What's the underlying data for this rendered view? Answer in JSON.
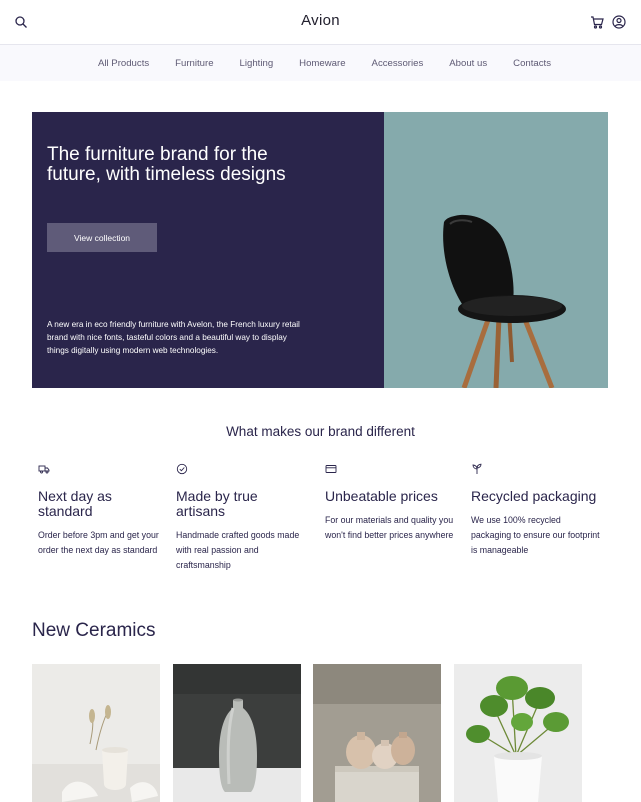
{
  "header": {
    "brand": "Avion",
    "icons": [
      "search-icon",
      "cart-icon",
      "user-icon"
    ]
  },
  "nav": {
    "items": [
      "All Products",
      "Furniture",
      "Lighting",
      "Homeware",
      "Accessories",
      "About us",
      "Contacts"
    ]
  },
  "hero": {
    "title": "The furniture brand for the future, with timeless designs",
    "button_label": "View collection",
    "text": "A new era in eco friendly furniture with Avelon, the French luxury retail brand with nice fonts, tasteful colors and a beautiful way to display things digitally using modern web technologies."
  },
  "features": {
    "title": "What makes our brand different",
    "items": [
      {
        "icon": "delivery-truck-icon",
        "title": "Next day as standard",
        "text": "Order before 3pm and get your order the next day as standard"
      },
      {
        "icon": "checkmark-circle-icon",
        "title": "Made by true artisans",
        "text": "Handmade crafted goods made with real passion and craftsmanship"
      },
      {
        "icon": "credit-card-icon",
        "title": "Unbeatable prices",
        "text": "For our materials and quality you won't find better prices anywhere"
      },
      {
        "icon": "sprout-icon",
        "title": "Recycled packaging",
        "text": "We use 100% recycled packaging to ensure our footprint is manageable"
      }
    ]
  },
  "ceramics": {
    "title": "New Ceramics"
  },
  "colors": {
    "primary": "#2a254b",
    "hero_accent": "#85aaac",
    "button": "#5f5b79",
    "nav_bg": "#f9f9fd"
  }
}
